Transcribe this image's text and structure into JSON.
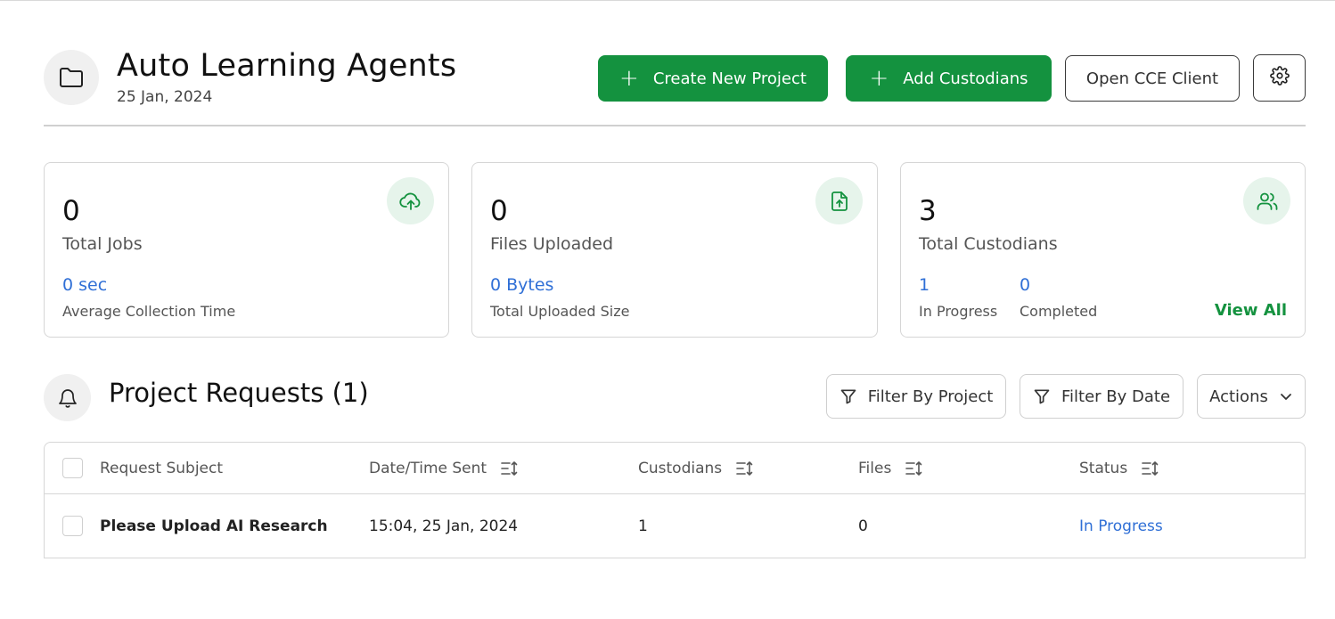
{
  "header": {
    "title": "Auto Learning Agents",
    "date": "25 Jan, 2024",
    "create_button": "Create New Project",
    "add_button": "Add Custodians",
    "open_button": "Open CCE Client"
  },
  "cards": {
    "jobs": {
      "value": "0",
      "label": "Total Jobs",
      "sub_value": "0 sec",
      "sub_label": "Average Collection Time"
    },
    "files": {
      "value": "0",
      "label": "Files Uploaded",
      "sub_value": "0 Bytes",
      "sub_label": "Total Uploaded Size"
    },
    "custodians": {
      "value": "3",
      "label": "Total Custodians",
      "in_progress_value": "1",
      "in_progress_label": "In Progress",
      "completed_value": "0",
      "completed_label": "Completed",
      "view_all": "View All"
    }
  },
  "requests": {
    "title": "Project Requests (1)",
    "filter_project": "Filter By Project",
    "filter_date": "Filter By Date",
    "actions": "Actions",
    "columns": {
      "subject": "Request Subject",
      "date": "Date/Time Sent",
      "custodians": "Custodians",
      "files": "Files",
      "status": "Status"
    },
    "rows": [
      {
        "subject": "Please Upload AI Research",
        "date": "15:04, 25 Jan, 2024",
        "custodians": "1",
        "files": "0",
        "status": "In Progress"
      }
    ]
  },
  "colors": {
    "primary_green": "#14923f",
    "link_blue": "#2f6fd6",
    "icon_bg": "#e6f4eb"
  }
}
